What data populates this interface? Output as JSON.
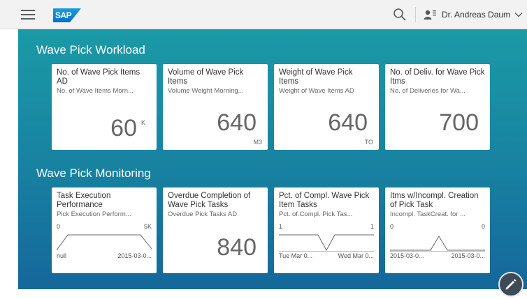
{
  "shell": {
    "logo_text": "SAP",
    "user_name": "Dr. Andreas Daum"
  },
  "sections": [
    {
      "title": "Wave Pick Workload"
    },
    {
      "title": "Wave Pick Monitoring"
    }
  ],
  "workload_tiles": [
    {
      "title": "No. of Wave Pick Items AD",
      "subtitle": "No. of Wave Items Morn...",
      "value": "60",
      "scale": "K",
      "unit": ""
    },
    {
      "title": "Volume of Wave Pick Items",
      "subtitle": "Volume Weight Morning...",
      "value": "640",
      "scale": "",
      "unit": "M3"
    },
    {
      "title": "Weight of Wave Pick Items",
      "subtitle": "Weight of Wave Items AD",
      "value": "640",
      "scale": "",
      "unit": "TO"
    },
    {
      "title": "No. of Deliv. for Wave Pick Itms",
      "subtitle": "No. of Deliveries for Wa...",
      "value": "700",
      "scale": "",
      "unit": ""
    }
  ],
  "monitoring_tiles": [
    {
      "title": "Task Execution Performance",
      "subtitle": "Pick Execution Perform...",
      "top_left": "0",
      "top_right": "5K",
      "bottom_left": "null",
      "bottom_right": "2015-03-0..."
    },
    {
      "title": "Overdue Completion of Wave Pick Tasks",
      "subtitle": "Overdue Pick Tasks AD",
      "value": "840"
    },
    {
      "title": "Pct. of Compl. Wave Pick Item Tasks",
      "subtitle": "Pct. of.Compl. Pick Tas...",
      "top_left": "1",
      "top_right": "1",
      "bottom_left": "Tue Mar 0...",
      "bottom_right": "Wed Mar 0..."
    },
    {
      "title": "Itms w/Incompl. Creation of Pick Task",
      "subtitle": "Incompl. TaskCreat. for ...",
      "top_left": "0",
      "top_right": "0",
      "bottom_left": "2015-03-0...",
      "bottom_right": "2015-03-0..."
    }
  ],
  "icons": {
    "menu": "hamburger-menu-icon",
    "search": "search-icon",
    "user": "user-icon",
    "chevron": "chevron-down-icon",
    "edit": "pencil-icon"
  },
  "colors": {
    "background_top": "#1a9aa6",
    "background_bottom": "#15679a",
    "tile_bg": "#ffffff",
    "brand": "#0a6fbe"
  }
}
